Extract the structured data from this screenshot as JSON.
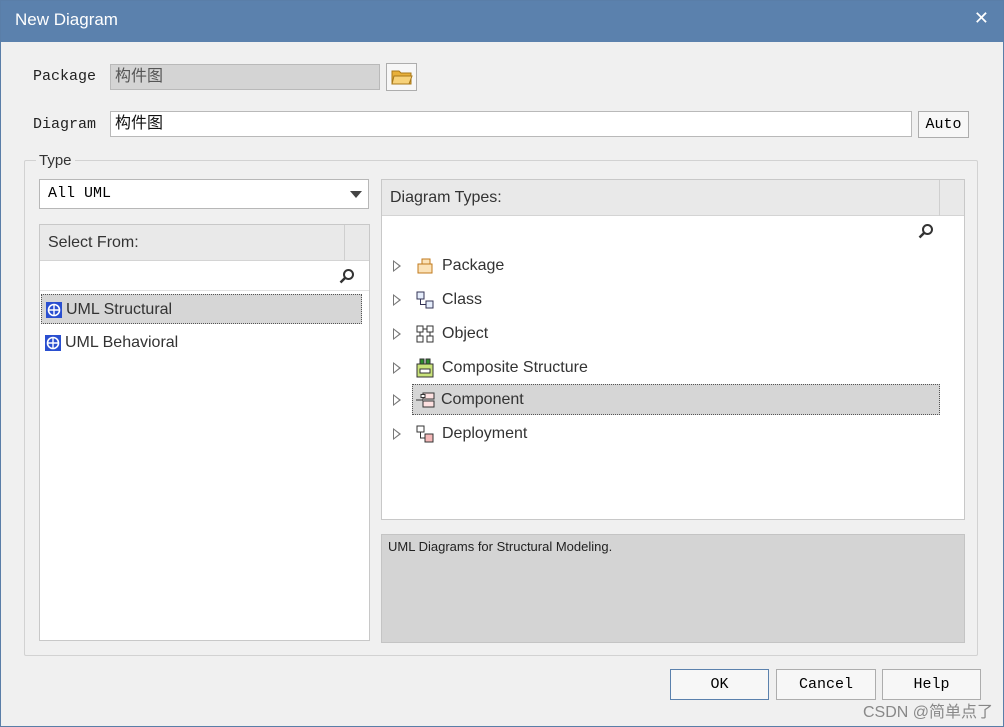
{
  "window": {
    "title": "New Diagram",
    "close_glyph": "✕"
  },
  "package": {
    "label": "Package",
    "value": "构件图"
  },
  "diagram": {
    "label": "Diagram",
    "value": "构件图",
    "auto_label": "Auto"
  },
  "type": {
    "group_label": "Type",
    "filter_value": "All UML",
    "select_from_header": "Select From:",
    "select_items": [
      {
        "label": "UML Structural",
        "selected": true
      },
      {
        "label": "UML Behavioral",
        "selected": false
      }
    ],
    "diagram_types_header": "Diagram Types:",
    "diagram_types": [
      {
        "label": "Package",
        "icon": "package-icon"
      },
      {
        "label": "Class",
        "icon": "class-icon"
      },
      {
        "label": "Object",
        "icon": "object-icon"
      },
      {
        "label": "Composite Structure",
        "icon": "composite-structure-icon"
      },
      {
        "label": "Component",
        "icon": "component-icon",
        "selected": true
      },
      {
        "label": "Deployment",
        "icon": "deployment-icon"
      }
    ],
    "description": "UML Diagrams for Structural Modeling."
  },
  "buttons": {
    "ok": "OK",
    "cancel": "Cancel",
    "help": "Help"
  },
  "watermark": "CSDN @简单点了"
}
